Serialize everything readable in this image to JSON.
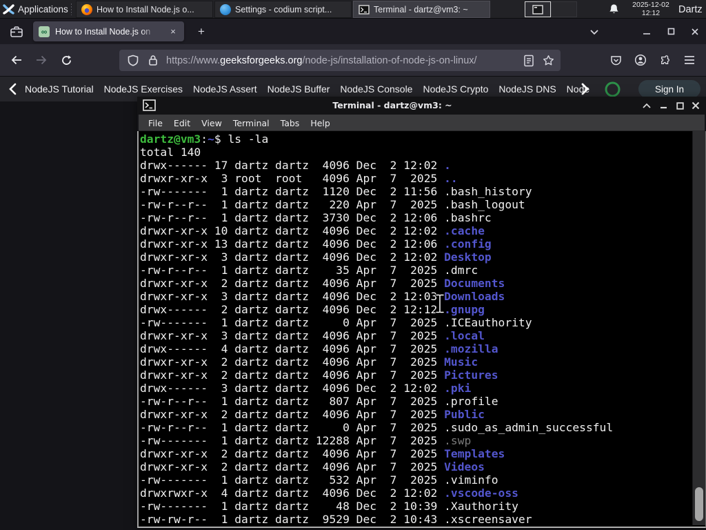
{
  "panel": {
    "applications_label": "Applications",
    "tasks": [
      {
        "icon": "firefox",
        "label": "How to Install Node.js o..."
      },
      {
        "icon": "vscodium",
        "label": "Settings - codium script..."
      },
      {
        "icon": "terminal",
        "label": "Terminal - dartz@vm3: ~",
        "active": true
      }
    ],
    "clock_date": "2025-12-02",
    "clock_time": "12:12",
    "user_label": "Dartz"
  },
  "browser": {
    "tab_title": "How to Install Node.js on",
    "new_tab_label": "+",
    "close_tab_label": "×",
    "url_scheme": "https://www.",
    "url_domain": "geeksforgeeks.org",
    "url_path": "/node-js/installation-of-node-js-on-linux/",
    "favicon_glyph": "∞",
    "nav_links": [
      "NodeJS Tutorial",
      "NodeJS Exercises",
      "NodeJS Assert",
      "NodeJS Buffer",
      "NodeJS Console",
      "NodeJS Crypto",
      "NodeJS DNS",
      "Node"
    ],
    "sign_in_label": "Sign In"
  },
  "terminal": {
    "title": "Terminal - dartz@vm3: ~",
    "menu": [
      "File",
      "Edit",
      "View",
      "Terminal",
      "Tabs",
      "Help"
    ],
    "prompt_userhost": "dartz@vm3",
    "prompt_path": "~",
    "prompt_command": "ls -la",
    "total_line": "total 140",
    "listing": [
      [
        "drwx------",
        "17",
        "dartz",
        "dartz",
        "4096",
        "Dec",
        "2",
        "12:02",
        ".",
        "dir"
      ],
      [
        "drwxr-xr-x",
        "3",
        "root",
        "root",
        "4096",
        "Apr",
        "7",
        "2025",
        "..",
        "dir"
      ],
      [
        "-rw-------",
        "1",
        "dartz",
        "dartz",
        "1120",
        "Dec",
        "2",
        "11:56",
        ".bash_history",
        "file"
      ],
      [
        "-rw-r--r--",
        "1",
        "dartz",
        "dartz",
        "220",
        "Apr",
        "7",
        "2025",
        ".bash_logout",
        "file"
      ],
      [
        "-rw-r--r--",
        "1",
        "dartz",
        "dartz",
        "3730",
        "Dec",
        "2",
        "12:06",
        ".bashrc",
        "file"
      ],
      [
        "drwxr-xr-x",
        "10",
        "dartz",
        "dartz",
        "4096",
        "Dec",
        "2",
        "12:02",
        ".cache",
        "dir"
      ],
      [
        "drwxr-xr-x",
        "13",
        "dartz",
        "dartz",
        "4096",
        "Dec",
        "2",
        "12:06",
        ".config",
        "dir"
      ],
      [
        "drwxr-xr-x",
        "3",
        "dartz",
        "dartz",
        "4096",
        "Dec",
        "2",
        "12:02",
        "Desktop",
        "dir"
      ],
      [
        "-rw-r--r--",
        "1",
        "dartz",
        "dartz",
        "35",
        "Apr",
        "7",
        "2025",
        ".dmrc",
        "file"
      ],
      [
        "drwxr-xr-x",
        "2",
        "dartz",
        "dartz",
        "4096",
        "Apr",
        "7",
        "2025",
        "Documents",
        "dir"
      ],
      [
        "drwxr-xr-x",
        "3",
        "dartz",
        "dartz",
        "4096",
        "Dec",
        "2",
        "12:03",
        "Downloads",
        "dir"
      ],
      [
        "drwx------",
        "2",
        "dartz",
        "dartz",
        "4096",
        "Dec",
        "2",
        "12:12",
        ".gnupg",
        "dir"
      ],
      [
        "-rw-------",
        "1",
        "dartz",
        "dartz",
        "0",
        "Apr",
        "7",
        "2025",
        ".ICEauthority",
        "file"
      ],
      [
        "drwxr-xr-x",
        "3",
        "dartz",
        "dartz",
        "4096",
        "Apr",
        "7",
        "2025",
        ".local",
        "dir"
      ],
      [
        "drwx------",
        "4",
        "dartz",
        "dartz",
        "4096",
        "Apr",
        "7",
        "2025",
        ".mozilla",
        "dir"
      ],
      [
        "drwxr-xr-x",
        "2",
        "dartz",
        "dartz",
        "4096",
        "Apr",
        "7",
        "2025",
        "Music",
        "dir"
      ],
      [
        "drwxr-xr-x",
        "2",
        "dartz",
        "dartz",
        "4096",
        "Apr",
        "7",
        "2025",
        "Pictures",
        "dir"
      ],
      [
        "drwx------",
        "3",
        "dartz",
        "dartz",
        "4096",
        "Dec",
        "2",
        "12:02",
        ".pki",
        "dir"
      ],
      [
        "-rw-r--r--",
        "1",
        "dartz",
        "dartz",
        "807",
        "Apr",
        "7",
        "2025",
        ".profile",
        "file"
      ],
      [
        "drwxr-xr-x",
        "2",
        "dartz",
        "dartz",
        "4096",
        "Apr",
        "7",
        "2025",
        "Public",
        "dir"
      ],
      [
        "-rw-r--r--",
        "1",
        "dartz",
        "dartz",
        "0",
        "Apr",
        "7",
        "2025",
        ".sudo_as_admin_successful",
        "file"
      ],
      [
        "-rw-------",
        "1",
        "dartz",
        "dartz",
        "12288",
        "Apr",
        "7",
        "2025",
        ".swp",
        "dim"
      ],
      [
        "drwxr-xr-x",
        "2",
        "dartz",
        "dartz",
        "4096",
        "Apr",
        "7",
        "2025",
        "Templates",
        "dir"
      ],
      [
        "drwxr-xr-x",
        "2",
        "dartz",
        "dartz",
        "4096",
        "Apr",
        "7",
        "2025",
        "Videos",
        "dir"
      ],
      [
        "-rw-------",
        "1",
        "dartz",
        "dartz",
        "532",
        "Apr",
        "7",
        "2025",
        ".viminfo",
        "file"
      ],
      [
        "drwxrwxr-x",
        "4",
        "dartz",
        "dartz",
        "4096",
        "Dec",
        "2",
        "12:02",
        ".vscode-oss",
        "dir"
      ],
      [
        "-rw-------",
        "1",
        "dartz",
        "dartz",
        "48",
        "Dec",
        "2",
        "10:39",
        ".Xauthority",
        "file"
      ],
      [
        "-rw-rw-r--",
        "1",
        "dartz",
        "dartz",
        "9529",
        "Dec",
        "2",
        "10:43",
        ".xscreensaver",
        "file"
      ]
    ],
    "colors": {
      "fg": "#f0f0f0",
      "green": "#3dbb3d",
      "blue": "#5356ce",
      "dim": "#7a7a7a",
      "bg": "#000000"
    }
  }
}
